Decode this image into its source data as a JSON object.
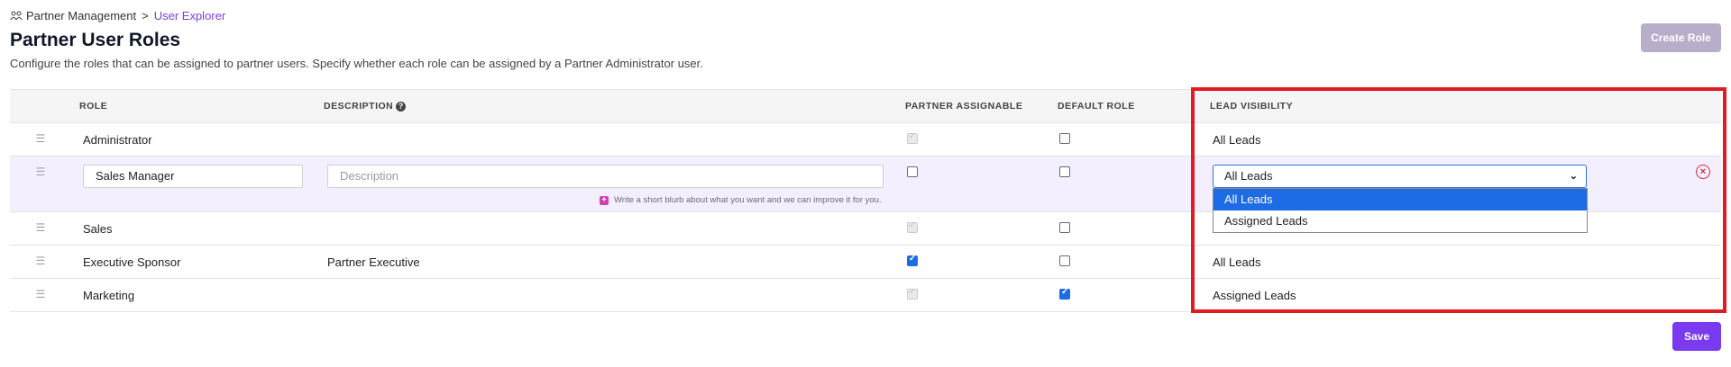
{
  "breadcrumb": {
    "icon": "partners-icon",
    "parent": "Partner Management",
    "separator": ">",
    "current": "User Explorer"
  },
  "page": {
    "title": "Partner User Roles",
    "subtitle": "Configure the roles that can be assigned to partner users. Specify whether each role can be assigned by a Partner Administrator user.",
    "create_button": "Create Role",
    "save_button": "Save"
  },
  "table": {
    "headers": {
      "role": "ROLE",
      "description": "DESCRIPTION",
      "partner_assignable": "PARTNER ASSIGNABLE",
      "default_role": "DEFAULT ROLE",
      "lead_visibility": "LEAD VISIBILITY"
    },
    "rows": [
      {
        "role": "Administrator",
        "description": "",
        "partner_assignable": "checked-disabled",
        "default_role": false,
        "lead_visibility": "All Leads"
      },
      {
        "role": "Sales Manager",
        "description": "",
        "description_placeholder": "Description",
        "ai_hint": "Write a short blurb about what you want and we can improve it for you.",
        "partner_assignable": false,
        "default_role": false,
        "lead_visibility": "All Leads",
        "editing": true
      },
      {
        "role": "Sales",
        "description": "",
        "partner_assignable": "checked-disabled",
        "default_role": false,
        "lead_visibility": ""
      },
      {
        "role": "Executive Sponsor",
        "description": "Partner Executive",
        "partner_assignable": true,
        "default_role": false,
        "lead_visibility": "All Leads"
      },
      {
        "role": "Marketing",
        "description": "",
        "partner_assignable": "checked-disabled",
        "default_role": true,
        "lead_visibility": "Assigned Leads"
      }
    ]
  },
  "lead_visibility_dropdown": {
    "options": [
      "All Leads",
      "Assigned Leads"
    ],
    "selected": "All Leads"
  },
  "colors": {
    "accent": "#7a3af0",
    "highlight": "#e01b24",
    "selected_option": "#1e6be6"
  }
}
